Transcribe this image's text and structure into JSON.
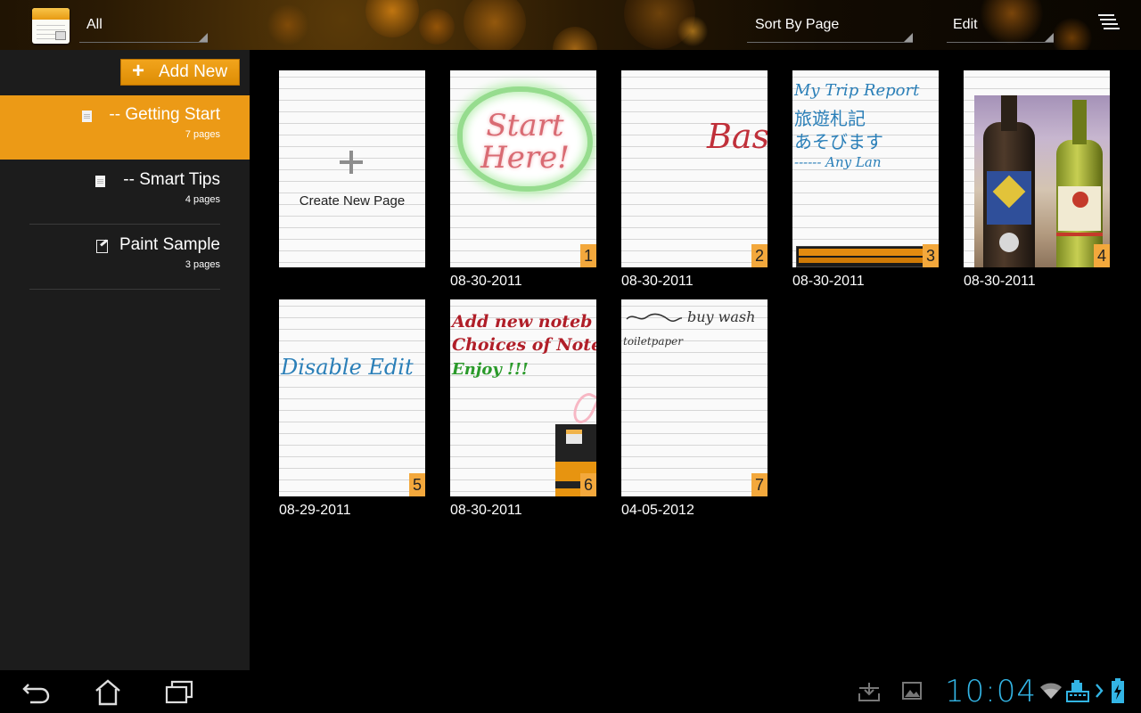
{
  "topbar": {
    "filter_label": "All",
    "sort_label": "Sort By Page",
    "edit_label": "Edit"
  },
  "sidebar": {
    "add_button_label": "Add New",
    "notebooks": [
      {
        "title": "-- Getting Start",
        "count": "7 pages",
        "icon": "notebook-icon",
        "selected": true
      },
      {
        "title": "-- Smart Tips",
        "count": "4 pages",
        "icon": "notebook-icon",
        "selected": false
      },
      {
        "title": "Paint Sample",
        "count": "3 pages",
        "icon": "paint-icon",
        "selected": false
      }
    ]
  },
  "grid": {
    "create_label": "Create New Page",
    "pages": [
      {
        "number": "1",
        "date": "08-30-2011",
        "content": [
          "Start",
          "Here!"
        ]
      },
      {
        "number": "2",
        "date": "08-30-2011",
        "content": [
          "Bas"
        ]
      },
      {
        "number": "3",
        "date": "08-30-2011",
        "content": [
          "My Trip Report",
          "旅遊札記",
          "あそびます",
          "------ Any Lan"
        ]
      },
      {
        "number": "4",
        "date": "08-30-2011",
        "content": []
      },
      {
        "number": "5",
        "date": "08-29-2011",
        "content": [
          "Disable Edit"
        ]
      },
      {
        "number": "6",
        "date": "08-30-2011",
        "content": [
          "Add new noteb",
          "Choices of Noteb",
          "Enjoy !!!"
        ]
      },
      {
        "number": "7",
        "date": "04-05-2012",
        "content": [
          "buy wash",
          "toiletpaper"
        ]
      }
    ]
  },
  "system_bar": {
    "time": "10:04"
  },
  "colors": {
    "accent": "#ec9a16",
    "page_badge": "#f3a83c",
    "clock": "#33b5e5"
  }
}
